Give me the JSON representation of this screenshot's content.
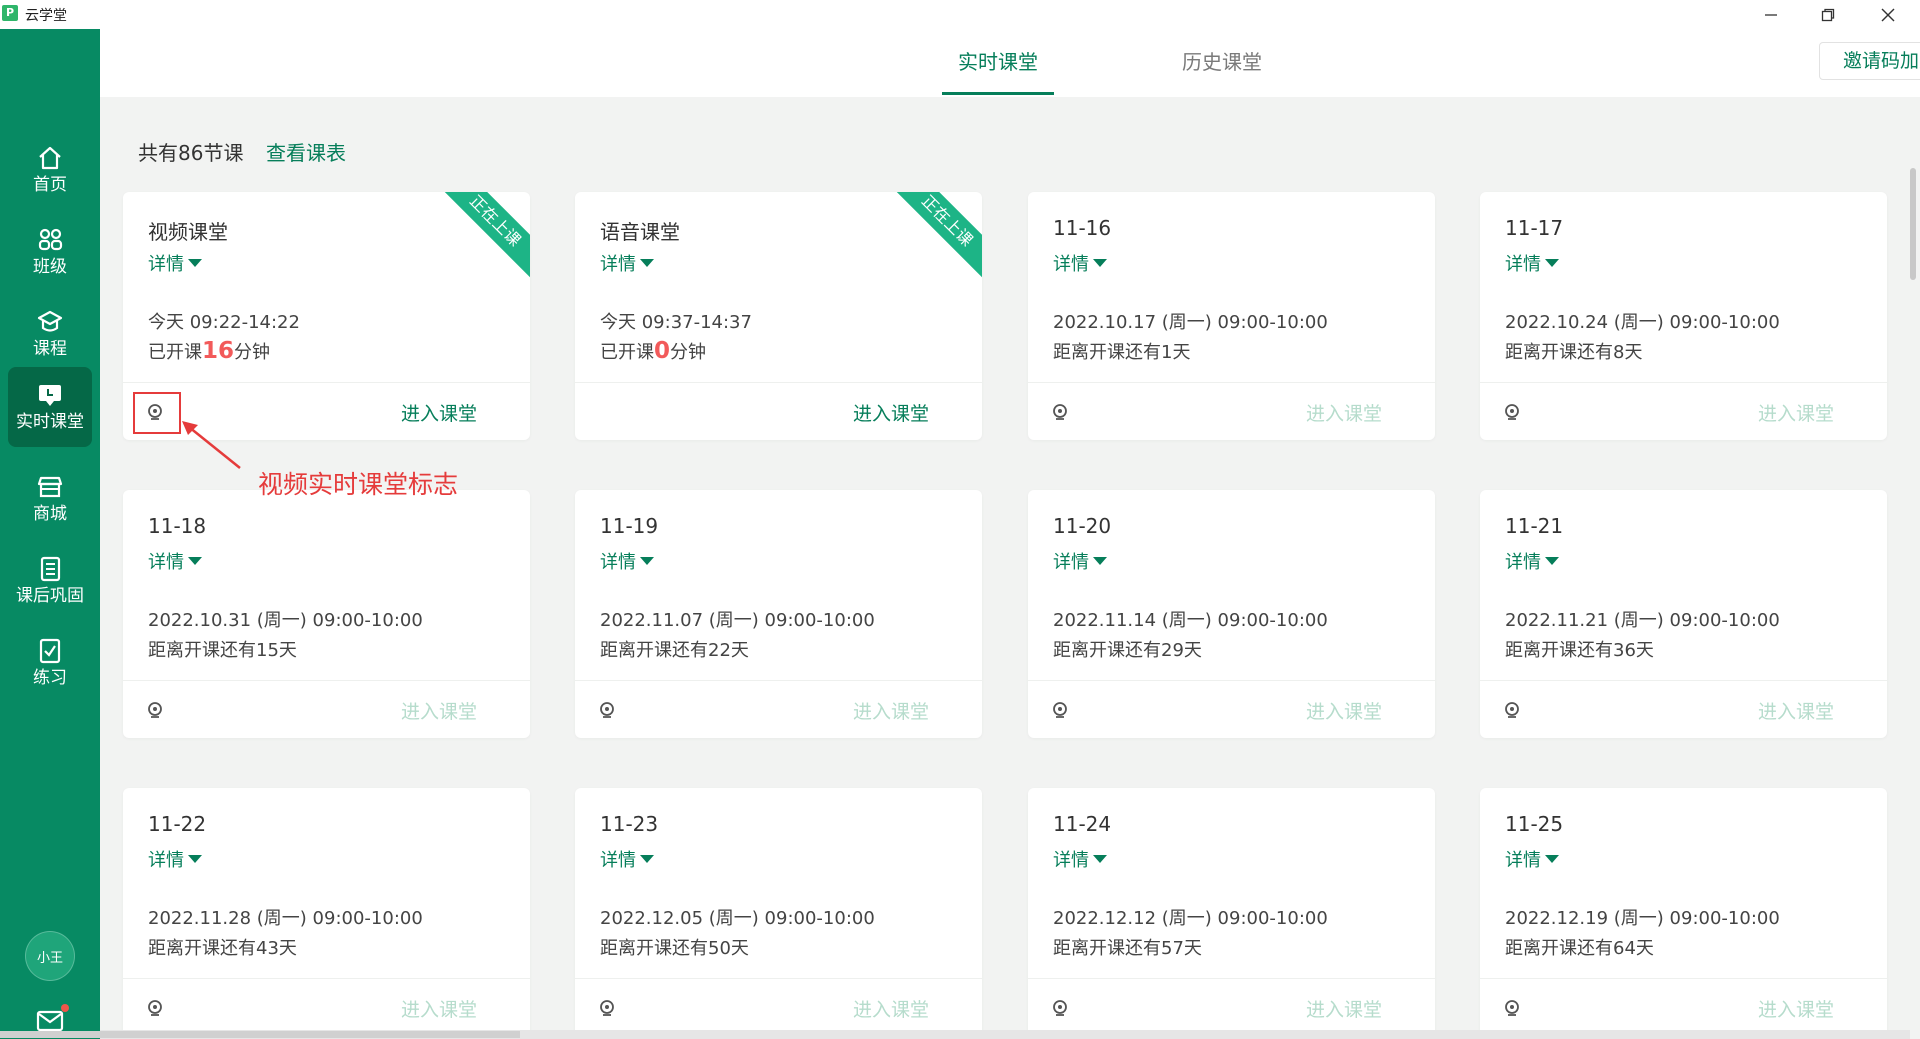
{
  "window": {
    "title": "云学堂",
    "logo": "P"
  },
  "sidebar": {
    "items": [
      {
        "label": "首页",
        "icon": "home-icon"
      },
      {
        "label": "班级",
        "icon": "class-icon"
      },
      {
        "label": "课程",
        "icon": "course-icon"
      },
      {
        "label": "实时课堂",
        "icon": "live-class-icon"
      },
      {
        "label": "商城",
        "icon": "store-icon"
      },
      {
        "label": "课后巩固",
        "icon": "review-icon"
      },
      {
        "label": "练习",
        "icon": "practice-icon"
      }
    ],
    "active_index": 3,
    "avatar": "小王",
    "accent": "#078a63"
  },
  "tabs": {
    "live": "实时课堂",
    "history": "历史课堂",
    "join_button": "邀请码加入课堂"
  },
  "header": {
    "count": "共有86节课",
    "schedule": "查看课表"
  },
  "annotation": "视频实时课堂标志",
  "cards": [
    {
      "title": "视频课堂",
      "detail": "详情",
      "time": "今天 09:22-14:22",
      "status_prefix": "已开课",
      "minutes": "16",
      "status_suffix": "分钟",
      "ribbon": "正在上课",
      "enter": "进入课堂"
    },
    {
      "title": "语音课堂",
      "detail": "详情",
      "time": "今天 09:37-14:37",
      "status_prefix": "已开课",
      "minutes": "0",
      "status_suffix": "分钟",
      "ribbon": "正在上课",
      "enter": "进入课堂"
    },
    {
      "title": "11-16",
      "detail": "详情",
      "time": "2022.10.17 (周一) 09:00-10:00",
      "status": "距离开课还有1天",
      "enter": "进入课堂"
    },
    {
      "title": "11-17",
      "detail": "详情",
      "time": "2022.10.24 (周一) 09:00-10:00",
      "status": "距离开课还有8天",
      "enter": "进入课堂"
    },
    {
      "title": "11-18",
      "detail": "详情",
      "time": "2022.10.31 (周一) 09:00-10:00",
      "status": "距离开课还有15天",
      "enter": "进入课堂"
    },
    {
      "title": "11-19",
      "detail": "详情",
      "time": "2022.11.07 (周一) 09:00-10:00",
      "status": "距离开课还有22天",
      "enter": "进入课堂"
    },
    {
      "title": "11-20",
      "detail": "详情",
      "time": "2022.11.14 (周一) 09:00-10:00",
      "status": "距离开课还有29天",
      "enter": "进入课堂"
    },
    {
      "title": "11-21",
      "detail": "详情",
      "time": "2022.11.21 (周一) 09:00-10:00",
      "status": "距离开课还有36天",
      "enter": "进入课堂"
    },
    {
      "title": "11-22",
      "detail": "详情",
      "time": "2022.11.28 (周一) 09:00-10:00",
      "status": "距离开课还有43天",
      "enter": "进入课堂"
    },
    {
      "title": "11-23",
      "detail": "详情",
      "time": "2022.12.05 (周一) 09:00-10:00",
      "status": "距离开课还有50天",
      "enter": "进入课堂"
    },
    {
      "title": "11-24",
      "detail": "详情",
      "time": "2022.12.12 (周一) 09:00-10:00",
      "status": "距离开课还有57天",
      "enter": "进入课堂"
    },
    {
      "title": "11-25",
      "detail": "详情",
      "time": "2022.12.19 (周一) 09:00-10:00",
      "status": "距离开课还有64天",
      "enter": "进入课堂"
    }
  ]
}
